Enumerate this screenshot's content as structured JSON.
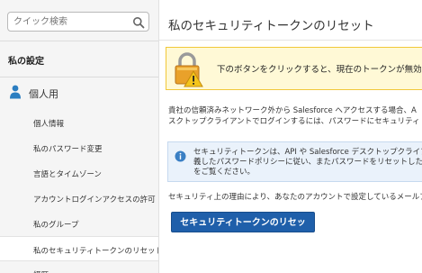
{
  "sidebar": {
    "search": {
      "placeholder": "クイック検索",
      "icon": "search-icon"
    },
    "settings_title": "私の設定",
    "section": {
      "label": "個人用",
      "icon": "person-icon"
    },
    "items": [
      {
        "label": "個人情報"
      },
      {
        "label": "私のパスワード変更"
      },
      {
        "label": "言語とタイムゾーン"
      },
      {
        "label": "アカウントログインアクセスの許可"
      },
      {
        "label": "私のグループ"
      },
      {
        "label": "私のセキュリティトークンのリセット",
        "active": true
      },
      {
        "label": "経歴"
      }
    ]
  },
  "main": {
    "title": "私のセキュリティトークンのリセット",
    "warning": {
      "icon": "lock-warning-icon",
      "text": "下のボタンをクリックすると、現在のトークンが無効になりま"
    },
    "body_lines": [
      "貴社の信頼済みネットワーク外から Salesforce へアクセスする場合、A",
      "スクトップクライアントでログインするには、パスワードにセキュリティトークン"
    ],
    "info": {
      "icon": "info-icon",
      "lines": [
        "セキュリティトークンは、API や Salesforce デスクトップクライアン",
        "義したパスワードポリシーに従い、またパスワードをリセットした際に",
        "をご覧ください。"
      ]
    },
    "note": "セキュリティ上の理由により、あなたのアカウントで設定しているメールア",
    "reset_button": "セキュリティトークンのリセット"
  },
  "colors": {
    "button": "#1f5faa",
    "warning_bg": "#fff9d6",
    "warning_border": "#f1c83a",
    "info_bg": "#eaf2fb",
    "sidebar_bg": "#f5f5f5",
    "person_icon": "#2b7ec1"
  }
}
